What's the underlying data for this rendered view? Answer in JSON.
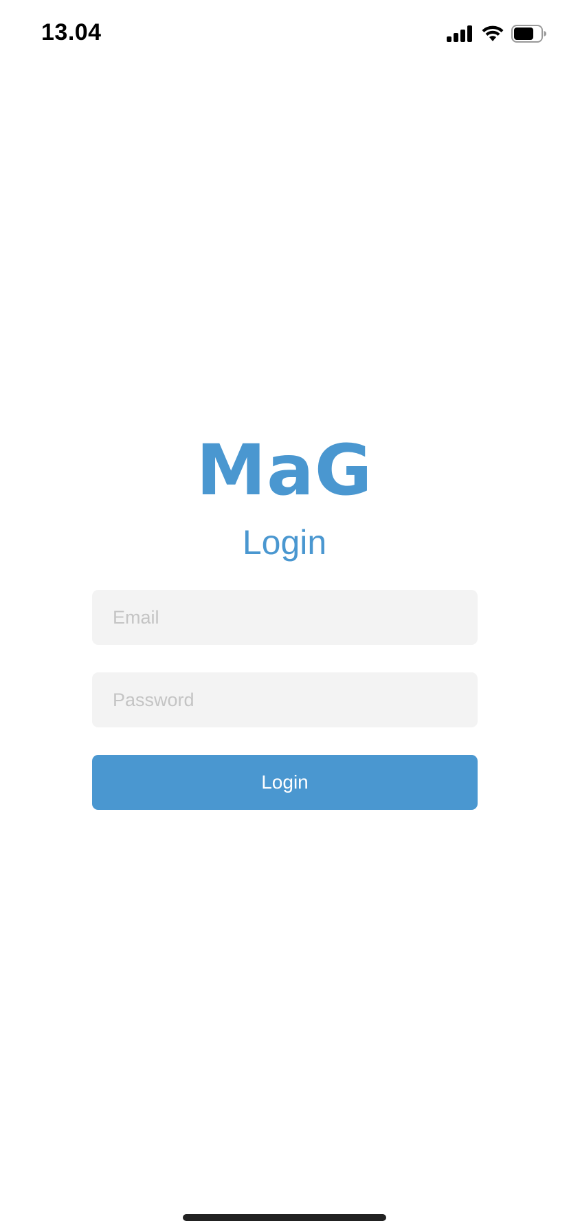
{
  "status_bar": {
    "time": "13.04",
    "icons": [
      "cellular-signal-icon",
      "wifi-icon",
      "battery-icon"
    ]
  },
  "brand": {
    "name": "MaG",
    "color": "#4a97d0"
  },
  "form": {
    "title": "Login",
    "email_placeholder": "Email",
    "email_value": "",
    "password_placeholder": "Password",
    "password_value": "",
    "submit_label": "Login",
    "button_color": "#4a97d0",
    "field_background": "#f3f3f3"
  }
}
